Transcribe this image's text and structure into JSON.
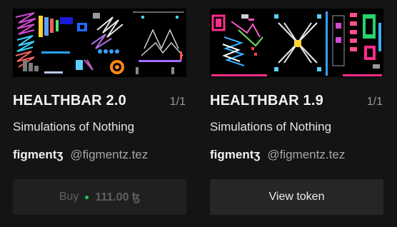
{
  "cards": [
    {
      "title": "HEALTHBAR 2.0",
      "editions": "1/1",
      "collection": "Simulations of Nothing",
      "artist_name": "figmentʒ",
      "artist_handle": "@figmentz.tez",
      "button": {
        "kind": "buy",
        "label": "Buy",
        "price": "111.00 ꜩ",
        "status_color": "#23c55e"
      }
    },
    {
      "title": "HEALTHBAR 1.9",
      "editions": "1/1",
      "collection": "Simulations of Nothing",
      "artist_name": "figmentʒ",
      "artist_handle": "@figmentz.tez",
      "button": {
        "kind": "view",
        "label": "View token"
      }
    }
  ]
}
